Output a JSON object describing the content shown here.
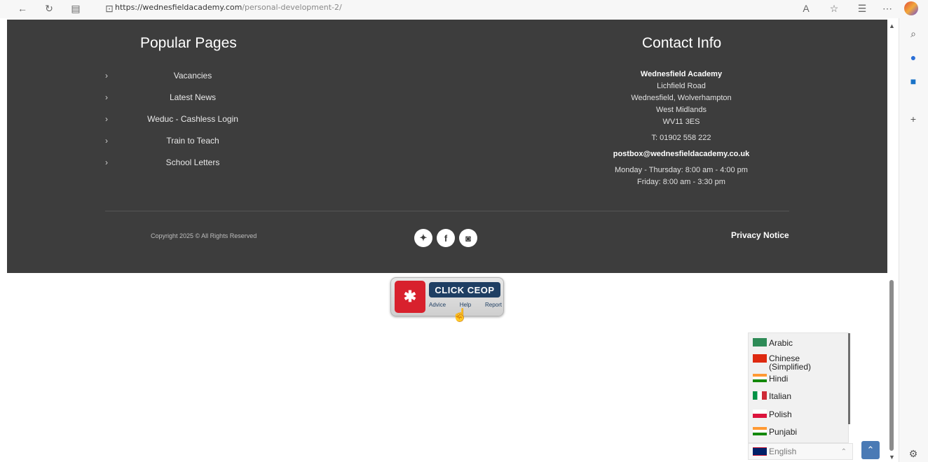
{
  "browser": {
    "url_host": "https://wednesfieldacademy.com",
    "url_path": "/personal-development-2/"
  },
  "footer": {
    "popular_pages": {
      "title": "Popular Pages",
      "items": [
        "Vacancies",
        "Latest News",
        "Weduc - Cashless Login",
        "Train to Teach",
        "School Letters"
      ]
    },
    "contact": {
      "title": "Contact Info",
      "name": "Wednesfield Academy",
      "address": [
        "Lichfield Road",
        "Wednesfield, Wolverhampton",
        "West Midlands",
        "WV11 3ES"
      ],
      "phone": "T: 01902 558 222",
      "email": "postbox@wednesfieldacademy.co.uk",
      "hours": [
        "Monday - Thursday: 8:00 am - 4:00 pm",
        "Friday: 8:00 am - 3:30 pm"
      ]
    },
    "copyright": "Copyright 2025 © All Rights Reserved",
    "privacy": "Privacy Notice"
  },
  "ceop": {
    "banner": "CLICK CEOP",
    "links": [
      "Advice",
      "Help",
      "Report"
    ]
  },
  "language": {
    "options": [
      "Arabic",
      "Chinese (Simplified)",
      "Hindi",
      "Italian",
      "Polish",
      "Punjabi"
    ],
    "selected": "English"
  }
}
